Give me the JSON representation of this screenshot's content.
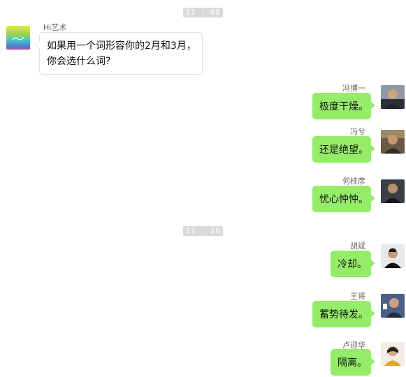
{
  "timestamps": [
    "17 : 00",
    "17 : 16"
  ],
  "incoming": {
    "sender": "Hi艺术",
    "avatar_text": "Hi艺术",
    "lines": [
      "如果用一个词形容你的2月和3月，",
      "你会选什么词?"
    ]
  },
  "replies": [
    {
      "name": "冯博一",
      "text": "极度干燥。"
    },
    {
      "name": "冯兮",
      "text": "还是绝望。"
    },
    {
      "name": "何桂彦",
      "text": "忧心忡忡。"
    },
    {
      "name": "胡斌",
      "text": "冷却。"
    },
    {
      "name": "王将",
      "text": "蓄势待发。"
    },
    {
      "name": "卢迎华",
      "text": "隔离。"
    }
  ],
  "colors": {
    "bubble_green": "#95ec69",
    "timestamp_bg": "#dadada"
  }
}
